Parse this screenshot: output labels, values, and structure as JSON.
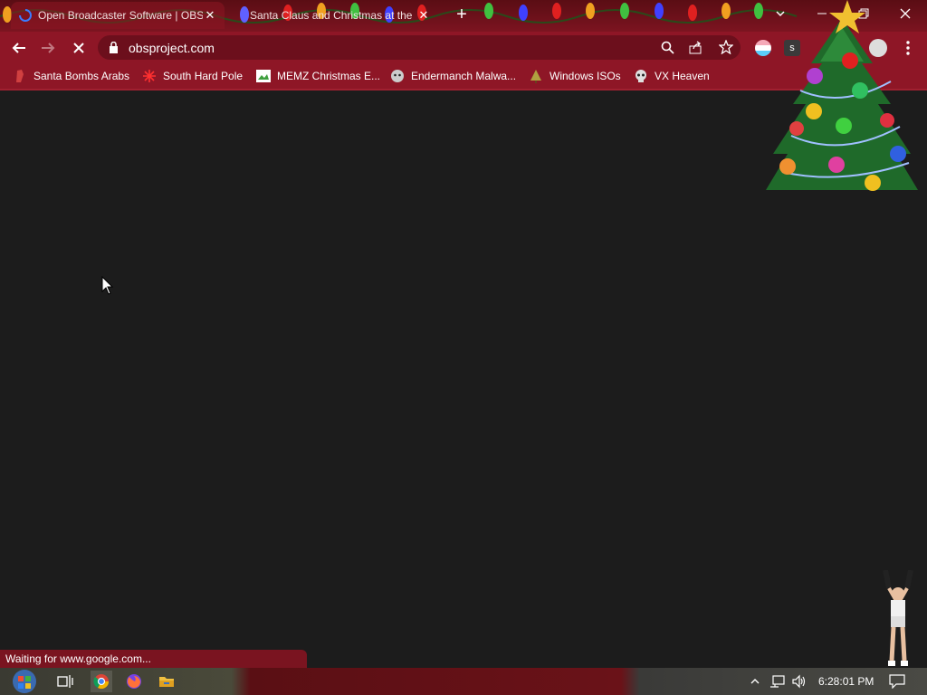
{
  "browser": {
    "tabs": [
      {
        "title": "Open Broadcaster Software | OBS",
        "active": true
      },
      {
        "title": "Santa Claus and Christmas at the",
        "active": false
      }
    ],
    "new_tab_label": "+",
    "close_glyph": "✕",
    "address": "obsproject.com",
    "bookmarks": [
      {
        "label": "Santa Bombs Arabs",
        "icon": "santa-icon"
      },
      {
        "label": "South Hard Pole",
        "icon": "snowflake-icon"
      },
      {
        "label": "MEMZ Christmas E...",
        "icon": "image-icon"
      },
      {
        "label": "Endermanch Malwa...",
        "icon": "wolf-icon"
      },
      {
        "label": "Windows ISOs",
        "icon": "tree-icon"
      },
      {
        "label": "VX Heaven",
        "icon": "skull-icon"
      }
    ],
    "status_text": "Waiting for www.google.com..."
  },
  "taskbar": {
    "clock": "6:28:01 PM"
  },
  "colors": {
    "tab_strip": "#5a0d14",
    "toolbar": "#8e1626",
    "omnibox": "#6c0f1c",
    "page_background": "#1c1c1c"
  }
}
